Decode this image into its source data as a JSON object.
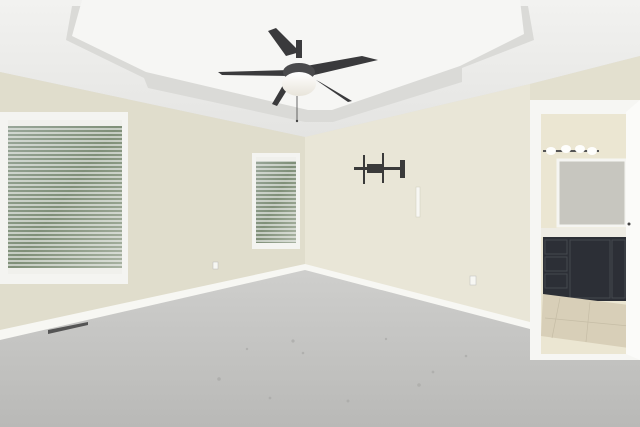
{
  "scene": {
    "kind": "empty carpeted bedroom photo",
    "colors": {
      "ceiling": "#e9e9e7",
      "tray_ceiling": "#f3f3f1",
      "left_wall": "#e6e3d3",
      "back_wall": "#e9e6d7",
      "right_wall": "#e3e0cf",
      "carpet": "#c3c3c1",
      "trim": "#f7f7f3",
      "fan_metal": "#3c3c3e",
      "vanity_cabinet": "#2c2f36",
      "tile_floor": "#d8cfb8"
    },
    "icons": [
      "ceiling-fan-icon",
      "tv-wall-mount-icon",
      "vanity-light-icon"
    ]
  }
}
